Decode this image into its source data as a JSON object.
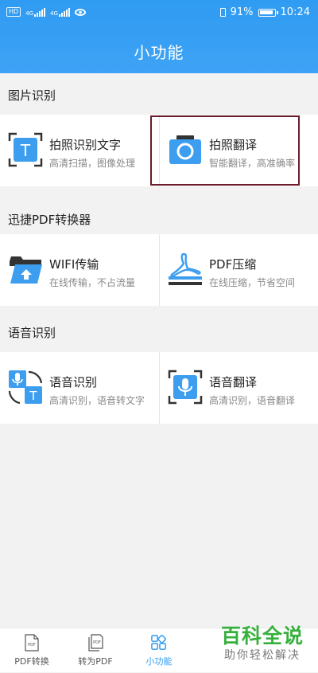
{
  "status_bar": {
    "left_chip": "HD",
    "net1": "4G",
    "net2": "4G",
    "battery": "91%",
    "time": "10:24"
  },
  "header": {
    "title": "小功能"
  },
  "sections": [
    {
      "title": "图片识别",
      "items": [
        {
          "name": "拍照识别文字",
          "desc": "高清扫描，图像处理",
          "icon": "text-recognition-icon",
          "glyph": "T"
        },
        {
          "name": "拍照翻译",
          "desc": "智能翻译，高准确率",
          "icon": "camera-icon"
        }
      ]
    },
    {
      "title": "迅捷PDF转换器",
      "items": [
        {
          "name": "WIFI传输",
          "desc": "在线传输，不占流量",
          "icon": "folder-upload-icon"
        },
        {
          "name": "PDF压缩",
          "desc": "在线压缩，节省空间",
          "icon": "pdf-compress-icon"
        }
      ]
    },
    {
      "title": "语音识别",
      "items": [
        {
          "name": "语音识别",
          "desc": "高清识别，语音转文字",
          "icon": "voice-to-text-icon",
          "glyph": "T"
        },
        {
          "name": "语音翻译",
          "desc": "高清识别，语音翻译",
          "icon": "voice-translate-icon"
        }
      ]
    }
  ],
  "bottom_nav": [
    {
      "label": "PDF转换",
      "icon": "pdf-doc-icon",
      "glyph": "PDF"
    },
    {
      "label": "转为PDF",
      "icon": "to-pdf-icon",
      "glyph": "PDF"
    },
    {
      "label": "小功能",
      "icon": "grid-icon",
      "active": true
    }
  ],
  "watermark": {
    "main": "百科全说",
    "sub": "助你轻松解决"
  },
  "colors": {
    "accent": "#2f9bf2",
    "highlight_border": "#6b1c2c",
    "watermark": "#36b03c"
  }
}
